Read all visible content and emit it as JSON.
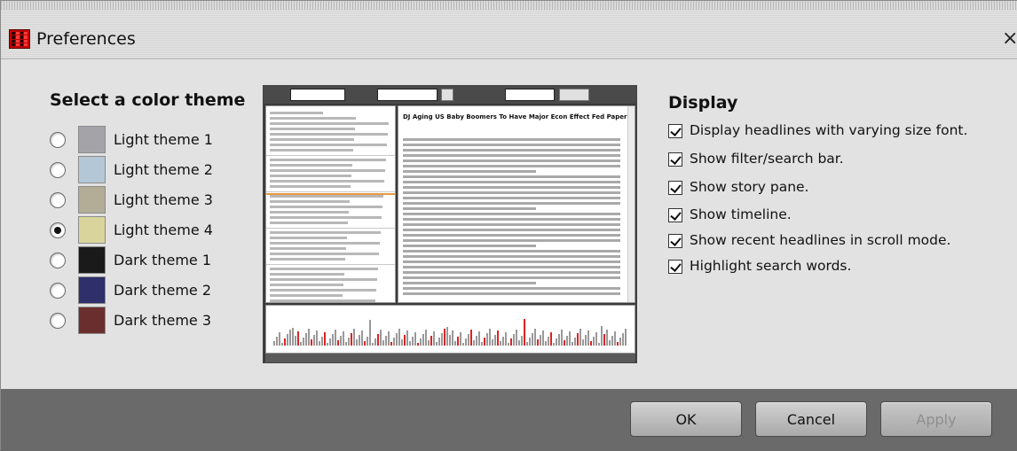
{
  "window": {
    "title": "Preferences",
    "close_symbol": "×"
  },
  "themes": {
    "heading": "Select a color theme",
    "selected": "Light theme 4",
    "items": [
      {
        "label": "Light theme 1",
        "color": "#a3a3a8",
        "checked": false
      },
      {
        "label": "Light theme 2",
        "color": "#b3c7d6",
        "checked": false
      },
      {
        "label": "Light theme 3",
        "color": "#b3ad98",
        "checked": false
      },
      {
        "label": "Light theme 4",
        "color": "#d8d49c",
        "checked": true
      },
      {
        "label": "Dark theme 1",
        "color": "#1a1a1a",
        "checked": false
      },
      {
        "label": "Dark theme 2",
        "color": "#2e2f6b",
        "checked": false
      },
      {
        "label": "Dark theme 3",
        "color": "#6a2e2e",
        "checked": false
      }
    ]
  },
  "preview": {
    "headline": "DJ Aging US Baby Boomers To Have Major Econ Effect Fed Paper"
  },
  "display": {
    "heading": "Display",
    "options": [
      {
        "label": "Display headlines with varying size font.",
        "checked": true
      },
      {
        "label": "Show filter/search bar.",
        "checked": true
      },
      {
        "label": "Show story pane.",
        "checked": true
      },
      {
        "label": "Show timeline.",
        "checked": true
      },
      {
        "label": "Show recent headlines in scroll mode.",
        "checked": true
      },
      {
        "label": "Highlight search words.",
        "checked": true
      }
    ]
  },
  "buttons": {
    "ok": "OK",
    "cancel": "Cancel",
    "apply": "Apply",
    "apply_enabled": false
  }
}
